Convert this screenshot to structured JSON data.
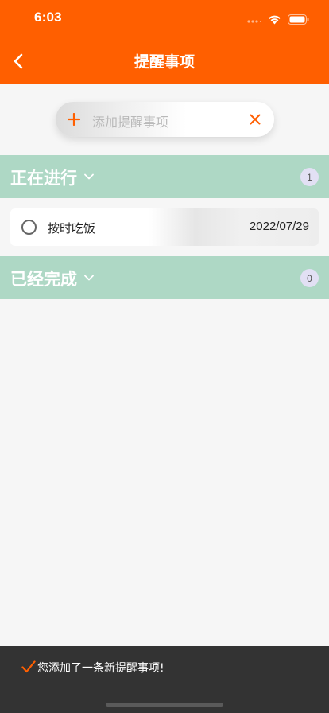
{
  "status_bar": {
    "time": "6:03"
  },
  "nav": {
    "title": "提醒事项"
  },
  "add_bar": {
    "placeholder": "添加提醒事项"
  },
  "sections": [
    {
      "title": "正在进行",
      "count": "1"
    },
    {
      "title": "已经完成",
      "count": "0"
    }
  ],
  "tasks": [
    {
      "label": "按时吃饭",
      "date": "2022/07/29"
    }
  ],
  "toast": {
    "message": "您添加了一条新提醒事项!"
  },
  "colors": {
    "brand": "#ff5f00",
    "section_bg": "#aed8c5",
    "badge_bg": "#e2e0f4",
    "toast_bg": "#333333"
  },
  "icons": [
    "back-arrow-icon",
    "plus-icon",
    "close-icon",
    "chevron-down-icon",
    "radio-unchecked-icon",
    "checkmark-icon",
    "signal-icon",
    "wifi-icon",
    "battery-icon"
  ]
}
